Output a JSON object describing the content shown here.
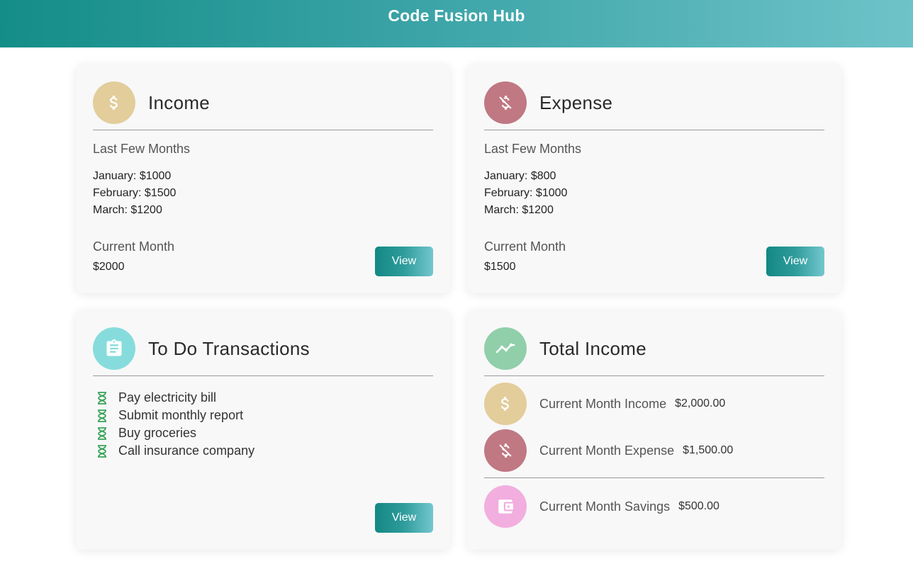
{
  "header": {
    "title": "Code Fusion Hub"
  },
  "colors": {
    "income_icon_bg": "#e2cd9b",
    "expense_icon_bg": "#c07882",
    "todo_icon_bg": "#86dcdc",
    "total_icon_bg": "#90cfaa",
    "savings_icon_bg": "#f2aede",
    "accent": "#148d88"
  },
  "income": {
    "title": "Income",
    "icon": "dollar-icon",
    "subtitle": "Last Few Months",
    "months": [
      "January: $1000",
      "February: $1500",
      "March: $1200"
    ],
    "current_label": "Current Month",
    "current_value": "$2000",
    "view_label": "View"
  },
  "expense": {
    "title": "Expense",
    "icon": "money-off-icon",
    "subtitle": "Last Few Months",
    "months": [
      "January: $800",
      "February: $1000",
      "March: $1200"
    ],
    "current_label": "Current Month",
    "current_value": "$1500",
    "view_label": "View"
  },
  "todo": {
    "title": "To Do Transactions",
    "icon": "clipboard-icon",
    "items": [
      "Pay electricity bill",
      "Submit monthly report",
      "Buy groceries",
      "Call insurance company"
    ],
    "item_icon": "hourglass-icon",
    "view_label": "View"
  },
  "total_income": {
    "title": "Total Income",
    "icon": "trend-line-icon",
    "rows": [
      {
        "label": "Current Month Income",
        "amount": "$2,000.00",
        "icon": "dollar-icon"
      },
      {
        "label": "Current Month Expense",
        "amount": "$1,500.00",
        "icon": "money-off-icon"
      },
      {
        "label": "Current Month Savings",
        "amount": "$500.00",
        "icon": "wallet-icon"
      }
    ]
  }
}
